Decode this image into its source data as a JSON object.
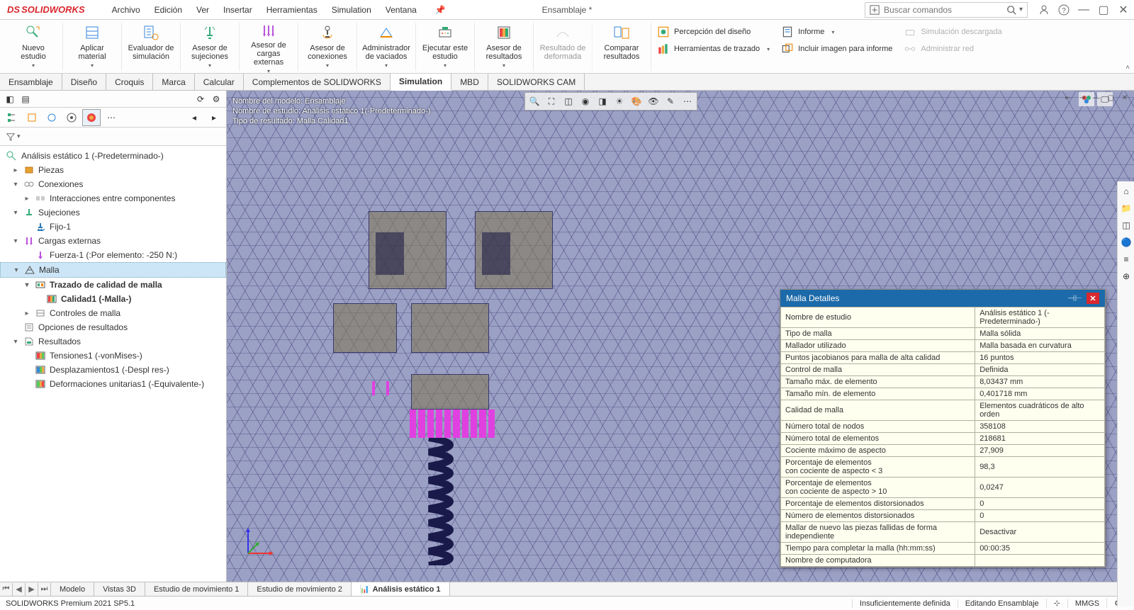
{
  "app": {
    "logo_prefix": "DS",
    "logo_name": "SOLIDWORKS",
    "document_title": "Ensamblaje *",
    "search_placeholder": "Buscar comandos"
  },
  "menus": [
    "Archivo",
    "Edición",
    "Ver",
    "Insertar",
    "Herramientas",
    "Simulation",
    "Ventana"
  ],
  "ribbon_large": [
    {
      "label": "Nuevo estudio",
      "dropdown": true
    },
    {
      "label": "Aplicar material",
      "dropdown": true
    },
    {
      "label": "Evaluador de simulación"
    },
    {
      "label": "Asesor de sujeciones",
      "dropdown": true
    },
    {
      "label": "Asesor de cargas externas",
      "dropdown": true
    },
    {
      "label": "Asesor de conexiones",
      "dropdown": true
    },
    {
      "label": "Administrador de vaciados",
      "dropdown": true
    },
    {
      "label": "Ejecutar este estudio",
      "dropdown": true
    },
    {
      "label": "Asesor de resultados",
      "dropdown": true
    },
    {
      "label": "Resultado de deformada",
      "disabled": true
    },
    {
      "label": "Comparar resultados"
    }
  ],
  "ribbon_rows_a": [
    {
      "label": "Percepción del diseño"
    },
    {
      "label": "Herramientas de trazado",
      "dropdown": true
    }
  ],
  "ribbon_rows_b": [
    {
      "label": "Informe",
      "dropdown": true
    },
    {
      "label": "Incluir imagen para informe"
    }
  ],
  "ribbon_rows_c": [
    {
      "label": "Simulación descargada",
      "disabled": true
    },
    {
      "label": "Administrar red",
      "disabled": true
    }
  ],
  "cmd_tabs": [
    "Ensamblaje",
    "Diseño",
    "Croquis",
    "Marca",
    "Calcular",
    "Complementos de SOLIDWORKS",
    "Simulation",
    "MBD",
    "SOLIDWORKS CAM"
  ],
  "cmd_tab_active": "Simulation",
  "viewport_info": {
    "line1": "Nombre del modelo: Ensamblaje",
    "line2": "Nombre de estudio: Análisis estático 1(-Predeterminado-)",
    "line3": "Tipo de resultado: Malla Calidad1"
  },
  "tree": {
    "root": "Análisis estático 1 (-Predeterminado-)",
    "items": [
      {
        "indent": 1,
        "label": "Piezas",
        "toggle": "▸",
        "icon": "parts"
      },
      {
        "indent": 1,
        "label": "Conexiones",
        "toggle": "▾",
        "icon": "connections"
      },
      {
        "indent": 2,
        "label": "Interacciones entre componentes",
        "toggle": "▸",
        "icon": "interaction"
      },
      {
        "indent": 1,
        "label": "Sujeciones",
        "toggle": "▾",
        "icon": "fixtures"
      },
      {
        "indent": 2,
        "label": "Fijo-1",
        "icon": "fixed"
      },
      {
        "indent": 1,
        "label": "Cargas externas",
        "toggle": "▾",
        "icon": "loads"
      },
      {
        "indent": 2,
        "label": "Fuerza-1 (:Por elemento: -250 N:)",
        "icon": "force"
      },
      {
        "indent": 1,
        "label": "Malla",
        "toggle": "▾",
        "icon": "mesh",
        "selected": true
      },
      {
        "indent": 2,
        "label": "Trazado de calidad de malla",
        "toggle": "▾",
        "icon": "quality",
        "bold": true
      },
      {
        "indent": 3,
        "label": "Calidad1 (-Malla-)",
        "icon": "plot",
        "bold": true
      },
      {
        "indent": 2,
        "label": "Controles de malla",
        "toggle": "▸",
        "icon": "controls"
      },
      {
        "indent": 1,
        "label": "Opciones de resultados",
        "icon": "options"
      },
      {
        "indent": 1,
        "label": "Resultados",
        "toggle": "▾",
        "icon": "results"
      },
      {
        "indent": 2,
        "label": "Tensiones1 (-vonMises-)",
        "icon": "stress"
      },
      {
        "indent": 2,
        "label": "Desplazamientos1 (-Despl res-)",
        "icon": "disp"
      },
      {
        "indent": 2,
        "label": "Deformaciones unitarias1 (-Equivalente-)",
        "icon": "strain"
      }
    ]
  },
  "details_panel": {
    "title": "Malla Detalles",
    "rows": [
      [
        "Nombre de estudio",
        "Análisis estático 1 (-Predeterminado-)"
      ],
      [
        "Tipo de malla",
        "Malla sólida"
      ],
      [
        "Mallador utilizado",
        "Malla basada en curvatura"
      ],
      [
        "Puntos jacobianos para malla de alta calidad",
        "16 puntos"
      ],
      [
        "Control de malla",
        "Definida"
      ],
      [
        "Tamaño máx. de elemento",
        "8,03437 mm"
      ],
      [
        "Tamaño mín. de elemento",
        "0,401718 mm"
      ],
      [
        "Calidad de malla",
        "Elementos cuadráticos de alto orden"
      ],
      [
        "Número total de nodos",
        "358108"
      ],
      [
        "Número total de elementos",
        "218681"
      ],
      [
        "Cociente máximo de aspecto",
        "27,909"
      ],
      [
        "Porcentaje de elementos\ncon cociente de aspecto < 3",
        "98,3"
      ],
      [
        "Porcentaje de elementos\ncon cociente de aspecto > 10",
        "0,0247"
      ],
      [
        "Porcentaje de elementos distorsionados",
        "0"
      ],
      [
        "Número de elementos distorsionados",
        "0"
      ],
      [
        "Mallar de nuevo las piezas fallidas de forma independiente",
        "Desactivar"
      ],
      [
        "Tiempo para completar la malla (hh:mm:ss)",
        "00:00:35"
      ],
      [
        "Nombre de computadora",
        ""
      ]
    ]
  },
  "bottom_tabs": [
    "Modelo",
    "Vistas 3D",
    "Estudio de movimiento 1",
    "Estudio de movimiento 2",
    "Análisis estático 1"
  ],
  "bottom_tab_active": "Análisis estático 1",
  "status": {
    "version": "SOLIDWORKS Premium 2021 SP5.1",
    "def": "Insuficientemente definida",
    "edit": "Editando Ensamblaje",
    "units": "MMGS"
  }
}
